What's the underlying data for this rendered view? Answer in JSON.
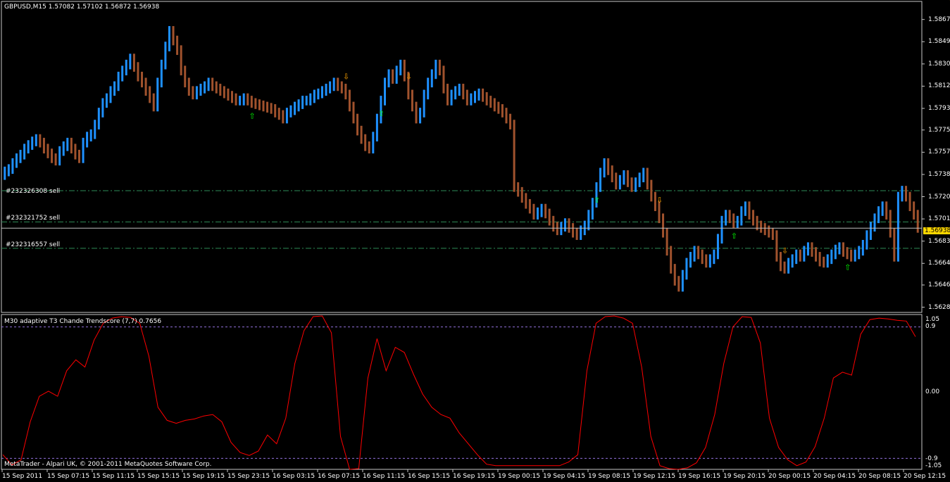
{
  "window": {
    "title": "GBPUSD,M15  1.57082 1.57102 1.56872 1.56938"
  },
  "colors": {
    "background": "#000000",
    "frame": "#c8c8c8",
    "bull_bar": "#1e90ff",
    "bear_bar": "#a0522d",
    "order_line": "#2e8b57",
    "price_line": "#c0c0c0",
    "price_tag": "#ffd700",
    "indicator_line": "#ff0000",
    "level_line": "#9370db",
    "up_arrow": "#00ff00",
    "down_arrow": "#ffa500"
  },
  "price_scale": {
    "ticks": [
      "1.58675",
      "1.58490",
      "1.58305",
      "1.58120",
      "1.57935",
      "1.57755",
      "1.57570",
      "1.57385",
      "1.57200",
      "1.57015",
      "1.56830",
      "1.56645",
      "1.56465",
      "1.56280"
    ],
    "current": "1.56938"
  },
  "orders": [
    {
      "label": "#232326308 sell",
      "price": 1.5725
    },
    {
      "label": "#232321752 sell",
      "price": 1.5699
    },
    {
      "label": "#232316557 sell",
      "price": 1.5677
    }
  ],
  "indicator": {
    "title": "M30   adaptive T3 Chande Trendscore (7,7) 0.7656",
    "ticks": [
      "1.05",
      "0.9",
      "0.00",
      "-0.9",
      "-1.05"
    ],
    "levels": [
      0.9,
      -0.9
    ]
  },
  "footer": {
    "copyright": "MetaTrader - Alpari UK, © 2001-2011 MetaQuotes Software Corp."
  },
  "time_axis": {
    "labels": [
      "15 Sep 2011",
      "15 Sep 07:15",
      "15 Sep 11:15",
      "15 Sep 15:15",
      "15 Sep 19:15",
      "15 Sep 23:15",
      "16 Sep 03:15",
      "16 Sep 07:15",
      "16 Sep 11:15",
      "16 Sep 15:15",
      "16 Sep 19:15",
      "19 Sep 00:15",
      "19 Sep 04:15",
      "19 Sep 08:15",
      "19 Sep 12:15",
      "19 Sep 16:15",
      "19 Sep 20:15",
      "20 Sep 00:15",
      "20 Sep 04:15",
      "20 Sep 08:15",
      "20 Sep 12:15"
    ]
  },
  "chart_data": [
    {
      "type": "bar",
      "title": "GBPUSD,M15  1.57082 1.57102 1.56872 1.56938",
      "ylim": [
        1.5626,
        1.5872
      ],
      "closes": [
        1.5741,
        1.5743,
        1.5748,
        1.5752,
        1.5755,
        1.576,
        1.5763,
        1.5766,
        1.5768,
        1.5765,
        1.576,
        1.5756,
        1.5752,
        1.575,
        1.5758,
        1.5762,
        1.5765,
        1.576,
        1.5755,
        1.5752,
        1.5765,
        1.577,
        1.5772,
        1.578,
        1.579,
        1.5798,
        1.5802,
        1.5808,
        1.5812,
        1.582,
        1.5825,
        1.583,
        1.5835,
        1.5828,
        1.582,
        1.5815,
        1.5808,
        1.5802,
        1.5795,
        1.5815,
        1.583,
        1.5845,
        1.5858,
        1.585,
        1.5842,
        1.5825,
        1.5815,
        1.5808,
        1.5805,
        1.5808,
        1.581,
        1.5812,
        1.5815,
        1.5812,
        1.581,
        1.5808,
        1.5806,
        1.5804,
        1.5802,
        1.58,
        1.58,
        1.5802,
        1.58,
        1.5798,
        1.5797,
        1.5796,
        1.5795,
        1.5794,
        1.5793,
        1.579,
        1.5788,
        1.5785,
        1.579,
        1.5792,
        1.5795,
        1.5797,
        1.58,
        1.58,
        1.5802,
        1.5805,
        1.5806,
        1.5808,
        1.581,
        1.5812,
        1.5815,
        1.5812,
        1.581,
        1.5805,
        1.5795,
        1.5785,
        1.5775,
        1.5768,
        1.5762,
        1.576,
        1.577,
        1.5785,
        1.58,
        1.5815,
        1.5822,
        1.5818,
        1.5825,
        1.583,
        1.582,
        1.5805,
        1.5795,
        1.5785,
        1.579,
        1.5805,
        1.5815,
        1.5822,
        1.583,
        1.5825,
        1.581,
        1.58,
        1.5805,
        1.5808,
        1.581,
        1.5805,
        1.58,
        1.5802,
        1.5804,
        1.5806,
        1.5803,
        1.58,
        1.5798,
        1.5795,
        1.5793,
        1.579,
        1.5785,
        1.578,
        1.5728,
        1.5724,
        1.5719,
        1.5714,
        1.571,
        1.5705,
        1.5707,
        1.571,
        1.5706,
        1.57,
        1.5695,
        1.5692,
        1.5695,
        1.5698,
        1.5694,
        1.569,
        1.5688,
        1.5692,
        1.5696,
        1.5705,
        1.5715,
        1.5728,
        1.574,
        1.5748,
        1.5742,
        1.5736,
        1.573,
        1.5734,
        1.5738,
        1.5732,
        1.5728,
        1.5732,
        1.5736,
        1.574,
        1.573,
        1.572,
        1.5712,
        1.5702,
        1.569,
        1.5675,
        1.566,
        1.565,
        1.5645,
        1.5655,
        1.5665,
        1.567,
        1.5675,
        1.5672,
        1.5668,
        1.5665,
        1.5668,
        1.5672,
        1.5685,
        1.57,
        1.5705,
        1.5702,
        1.5698,
        1.57,
        1.5708,
        1.5712,
        1.5705,
        1.57,
        1.5696,
        1.5694,
        1.5692,
        1.569,
        1.5688,
        1.567,
        1.5662,
        1.566,
        1.5665,
        1.5668,
        1.5672,
        1.567,
        1.5675,
        1.5678,
        1.5674,
        1.567,
        1.5666,
        1.5665,
        1.5668,
        1.5672,
        1.5676,
        1.5678,
        1.5674,
        1.5672,
        1.567,
        1.5672,
        1.5675,
        1.568,
        1.5688,
        1.5695,
        1.5702,
        1.5708,
        1.5712,
        1.5705,
        1.569,
        1.567,
        1.572,
        1.5725,
        1.572,
        1.5712,
        1.5705,
        1.5694
      ]
    },
    {
      "type": "line",
      "title": "M30   adaptive T3 Chande Trendscore (7,7) 0.7656",
      "ylim": [
        -1.05,
        1.05
      ],
      "values": [
        -0.85,
        -0.99,
        -0.92,
        -0.4,
        -0.05,
        0.02,
        -0.05,
        0.3,
        0.45,
        0.35,
        0.72,
        0.95,
        1.02,
        1.04,
        1.03,
        0.95,
        0.5,
        -0.2,
        -0.38,
        -0.42,
        -0.38,
        -0.36,
        -0.32,
        -0.3,
        -0.4,
        -0.68,
        -0.82,
        -0.86,
        -0.8,
        -0.58,
        -0.7,
        -0.35,
        0.4,
        0.85,
        1.04,
        1.05,
        0.82,
        -0.6,
        -1.05,
        -1.04,
        0.2,
        0.74,
        0.3,
        0.62,
        0.55,
        0.25,
        -0.02,
        -0.2,
        -0.3,
        -0.35,
        -0.55,
        -0.7,
        -0.85,
        -0.98,
        -1.0,
        -1.0,
        -1.0,
        -1.0,
        -1.0,
        -1.0,
        -1.0,
        -1.0,
        -0.95,
        -0.85,
        0.3,
        0.95,
        1.04,
        1.05,
        1.02,
        0.95,
        0.35,
        -0.6,
        -1.0,
        -1.04,
        -1.05,
        -1.03,
        -0.96,
        -0.75,
        -0.3,
        0.4,
        0.9,
        1.04,
        1.03,
        0.68,
        -0.35,
        -0.75,
        -0.92,
        -1.0,
        -0.95,
        -0.74,
        -0.35,
        0.2,
        0.28,
        0.24,
        0.8,
        1.0,
        1.02,
        1.01,
        0.99,
        0.98,
        0.7656
      ]
    }
  ]
}
